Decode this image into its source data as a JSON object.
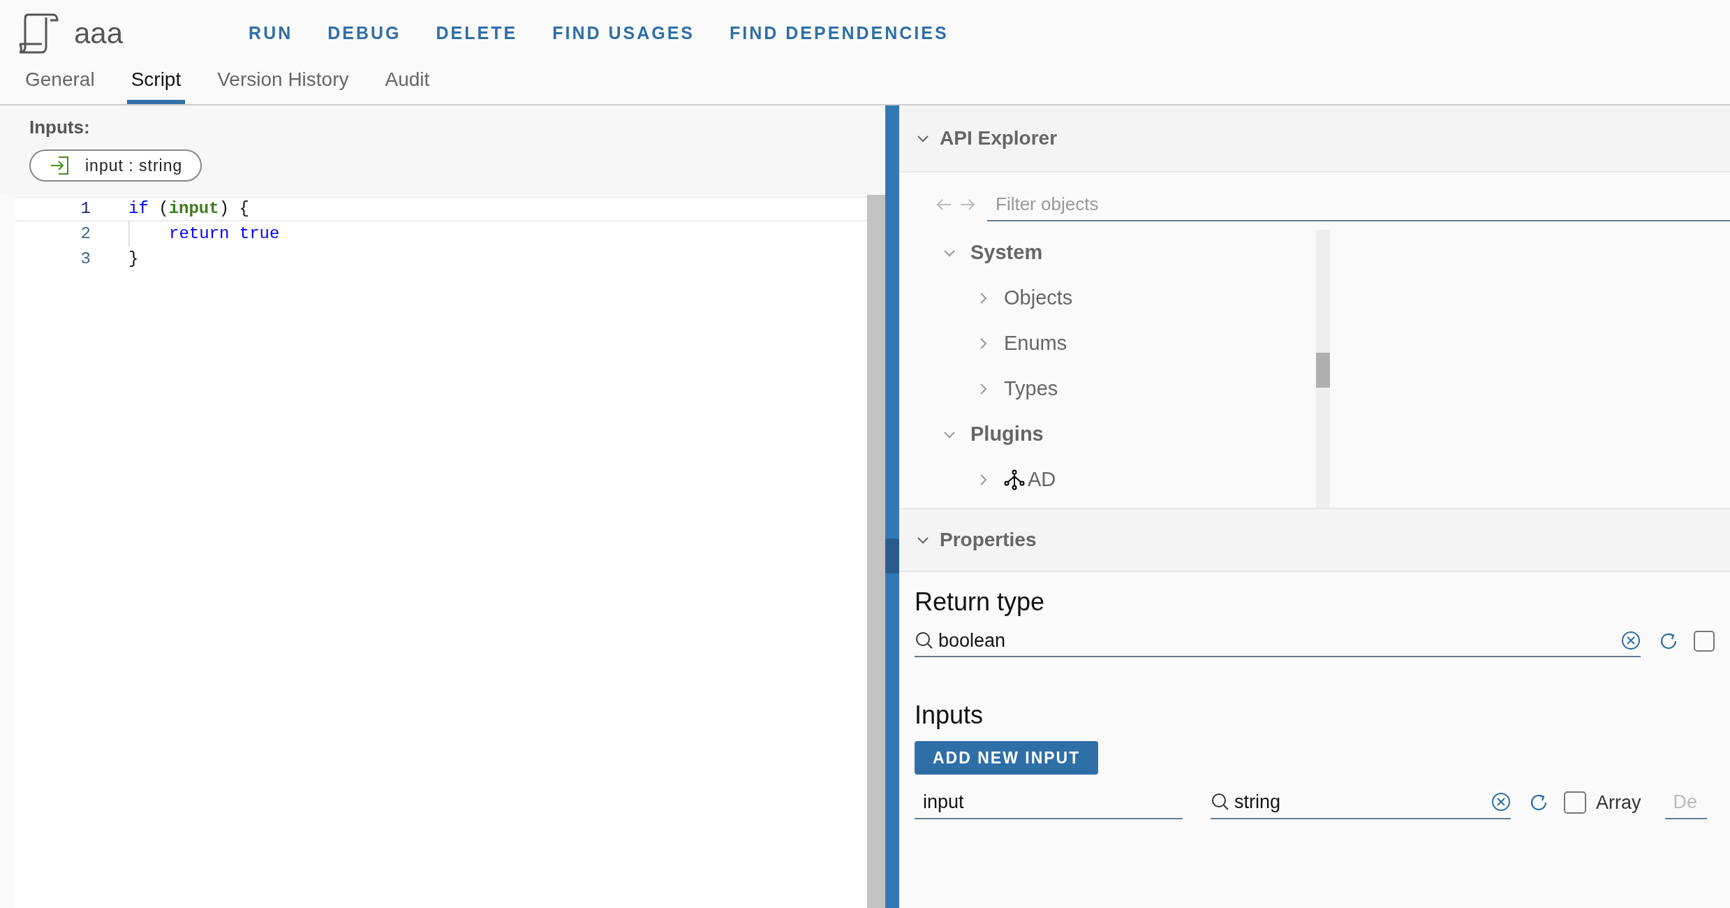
{
  "header": {
    "title": "aaa",
    "actions": [
      "RUN",
      "DEBUG",
      "DELETE",
      "FIND USAGES",
      "FIND DEPENDENCIES"
    ]
  },
  "tabs": [
    {
      "label": "General",
      "selected": false
    },
    {
      "label": "Script",
      "selected": true
    },
    {
      "label": "Version History",
      "selected": false
    },
    {
      "label": "Audit",
      "selected": false
    }
  ],
  "inputs_section": {
    "label": "Inputs:",
    "chips": [
      "input : string"
    ]
  },
  "editor": {
    "lines": [
      {
        "number": "1",
        "active": true,
        "indented": false,
        "tokens": [
          {
            "text": "if",
            "kind": "keyword"
          },
          {
            "text": " (",
            "kind": "plain"
          },
          {
            "text": "input",
            "kind": "param"
          },
          {
            "text": ") {",
            "kind": "plain"
          }
        ]
      },
      {
        "number": "2",
        "active": false,
        "indented": true,
        "tokens": [
          {
            "text": "return true",
            "kind": "keyword"
          }
        ]
      },
      {
        "number": "3",
        "active": false,
        "indented": false,
        "tokens": [
          {
            "text": "}",
            "kind": "plain"
          }
        ]
      }
    ]
  },
  "api_explorer": {
    "title": "API Explorer",
    "expanded": true,
    "filter": {
      "placeholder": "Filter objects"
    },
    "tree": [
      {
        "label": "System",
        "expanded": true,
        "children": [
          {
            "label": "Objects",
            "expanded": false
          },
          {
            "label": "Enums",
            "expanded": false
          },
          {
            "label": "Types",
            "expanded": false
          }
        ]
      },
      {
        "label": "Plugins",
        "expanded": true,
        "children": [
          {
            "label": "AD",
            "expanded": false,
            "kind": "plugin"
          }
        ]
      }
    ]
  },
  "properties": {
    "title": "Properties",
    "expanded": true,
    "return_type": {
      "label": "Return type",
      "value": "boolean",
      "array_checked": false
    },
    "inputs": {
      "label": "Inputs",
      "add_button": "ADD NEW INPUT",
      "rows": [
        {
          "name": "input",
          "type": "string",
          "array_label": "Array",
          "array_checked": false,
          "default_placeholder": "De"
        }
      ]
    }
  }
}
